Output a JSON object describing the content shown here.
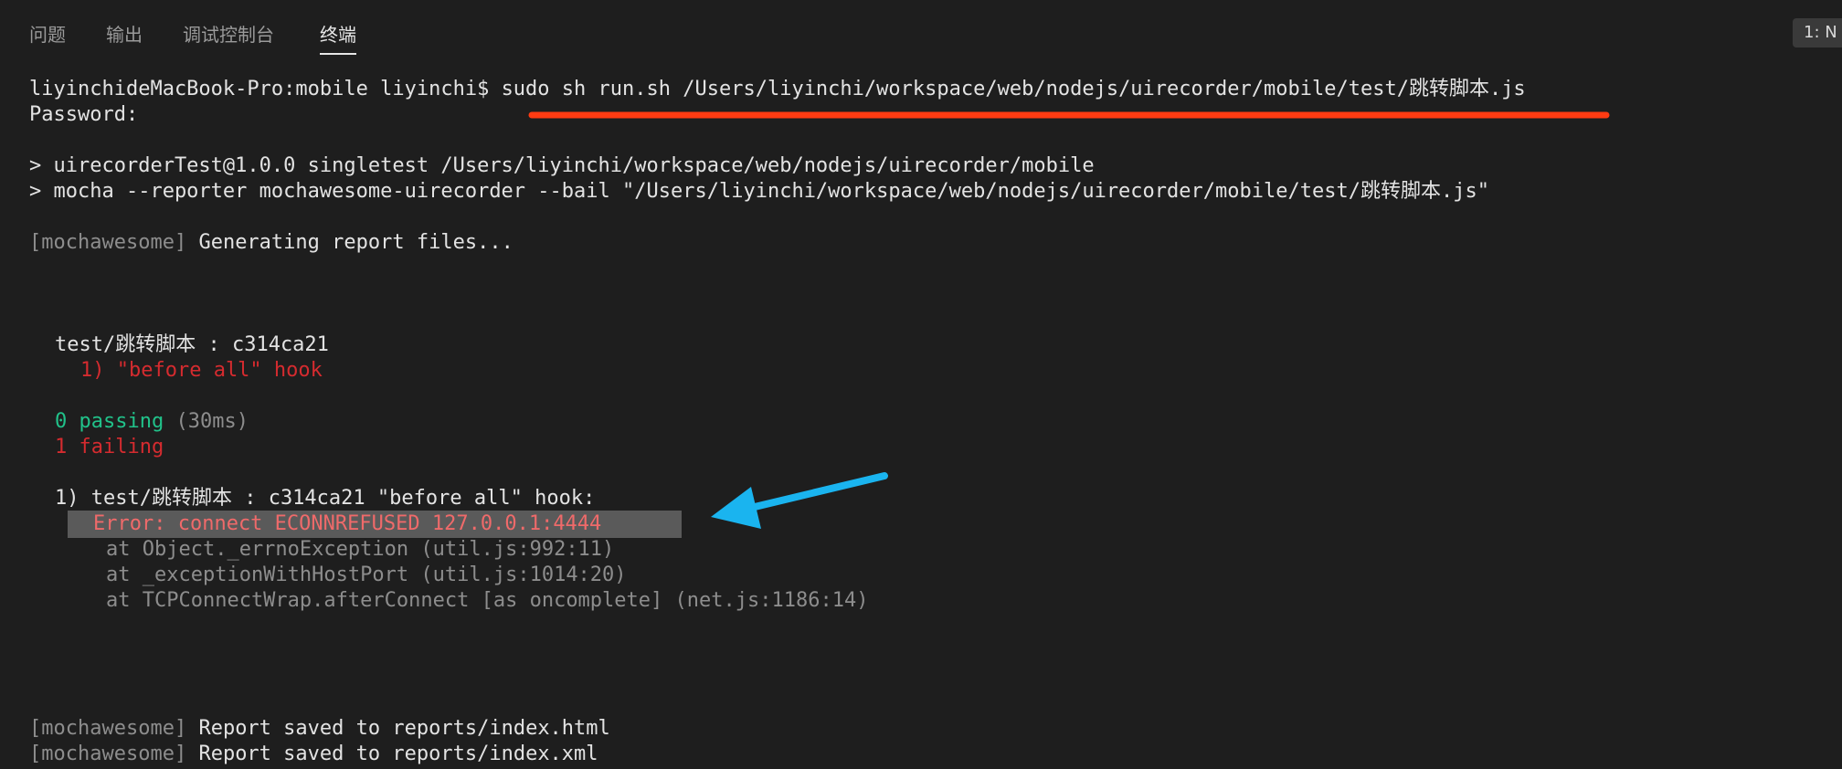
{
  "tabs": [
    {
      "label": "问题",
      "active": false
    },
    {
      "label": "输出",
      "active": false
    },
    {
      "label": "调试控制台",
      "active": false
    },
    {
      "label": "终端",
      "active": true
    }
  ],
  "panel_select": "1: N",
  "terminal": {
    "prompt": "liyinchideMacBook-Pro:mobile liyinchi$ ",
    "command": "sudo sh run.sh /Users/liyinchi/workspace/web/nodejs/uirecorder/mobile/test/跳转脚本.js",
    "password": "Password:",
    "npm_line1": "> uirecorderTest@1.0.0 singletest /Users/liyinchi/workspace/web/nodejs/uirecorder/mobile",
    "npm_line2": "> mocha --reporter mochawesome-uirecorder --bail \"/Users/liyinchi/workspace/web/nodejs/uirecorder/mobile/test/跳转脚本.js\"",
    "bracket_open": "[",
    "mochawesome": "mochawesome",
    "bracket_close": "] ",
    "generating": "Generating report files...",
    "suite": "test/跳转脚本 : c314ca21",
    "failed_hook": "1) \"before all\" hook",
    "passing_count": "0 passing",
    "passing_time": " (30ms)",
    "failing": "1 failing",
    "fail_title": "1) test/跳转脚本 : c314ca21 \"before all\" hook:",
    "error": "Error: connect ECONNREFUSED 127.0.0.1:4444",
    "stack": [
      "at Object._errnoException (util.js:992:11)",
      "at _exceptionWithHostPort (util.js:1014:20)",
      "at TCPConnectWrap.afterConnect [as oncomplete] (net.js:1186:14)"
    ],
    "report_html": "Report saved to reports/index.html",
    "report_xml": "Report saved to reports/index.xml"
  },
  "colors": {
    "background": "#1e1e1e",
    "error_red": "#d52b2f",
    "pass_green": "#21c28a",
    "underline_annotation": "#ff3b12",
    "arrow_annotation": "#1ab4ef"
  }
}
